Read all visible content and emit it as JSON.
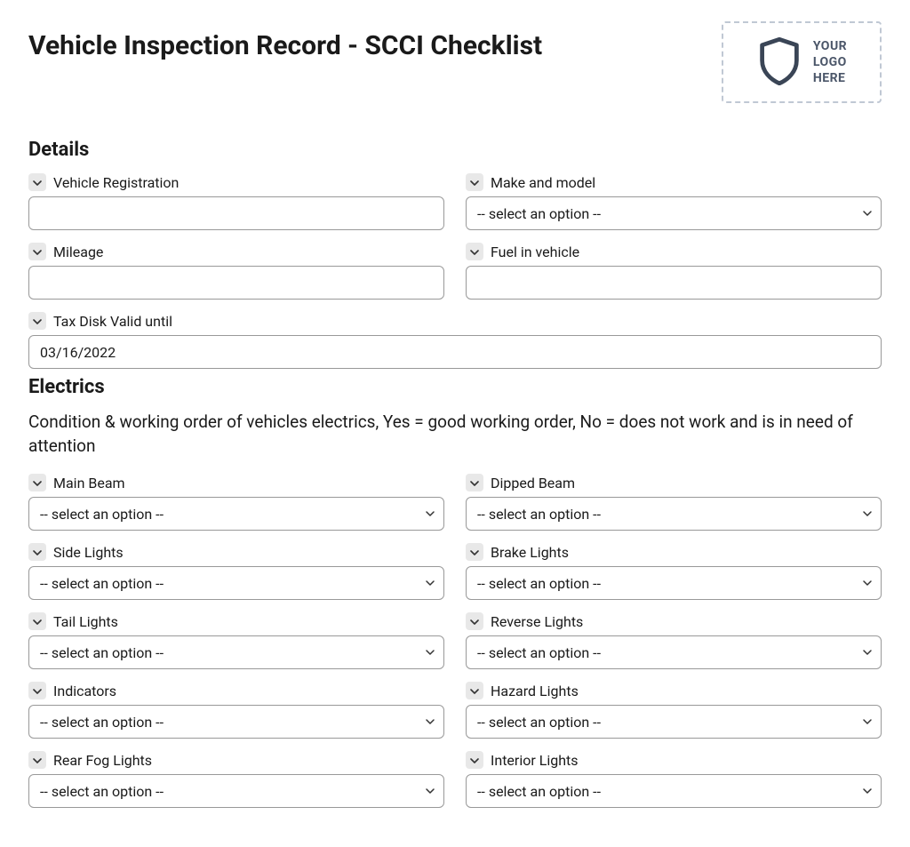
{
  "page_title": "Vehicle Inspection Record - SCCI Checklist",
  "logo_text": "YOUR\nLOGO\nHERE",
  "select_placeholder": "-- select an option --",
  "sections": {
    "details": {
      "heading": "Details",
      "fields": {
        "vehicle_registration": {
          "label": "Vehicle Registration",
          "type": "text",
          "value": ""
        },
        "make_model": {
          "label": "Make and model",
          "type": "select",
          "value": "-- select an option --"
        },
        "mileage": {
          "label": "Mileage",
          "type": "text",
          "value": ""
        },
        "fuel": {
          "label": "Fuel in vehicle",
          "type": "text",
          "value": ""
        },
        "tax_disk": {
          "label": "Tax Disk Valid until",
          "type": "text",
          "value": "03/16/2022"
        }
      }
    },
    "electrics": {
      "heading": "Electrics",
      "description": "Condition & working order of vehicles electrics, Yes = good working order, No = does not work and is in need of attention",
      "fields": {
        "main_beam": {
          "label": "Main Beam",
          "type": "select",
          "value": "-- select an option --"
        },
        "dipped_beam": {
          "label": "Dipped Beam",
          "type": "select",
          "value": "-- select an option --"
        },
        "side_lights": {
          "label": "Side Lights",
          "type": "select",
          "value": "-- select an option --"
        },
        "brake_lights": {
          "label": "Brake Lights",
          "type": "select",
          "value": "-- select an option --"
        },
        "tail_lights": {
          "label": "Tail Lights",
          "type": "select",
          "value": "-- select an option --"
        },
        "reverse_lights": {
          "label": "Reverse Lights",
          "type": "select",
          "value": "-- select an option --"
        },
        "indicators": {
          "label": "Indicators",
          "type": "select",
          "value": "-- select an option --"
        },
        "hazard_lights": {
          "label": "Hazard Lights",
          "type": "select",
          "value": "-- select an option --"
        },
        "rear_fog_lights": {
          "label": "Rear Fog Lights",
          "type": "select",
          "value": "-- select an option --"
        },
        "interior_lights": {
          "label": "Interior Lights",
          "type": "select",
          "value": "-- select an option --"
        }
      }
    }
  }
}
